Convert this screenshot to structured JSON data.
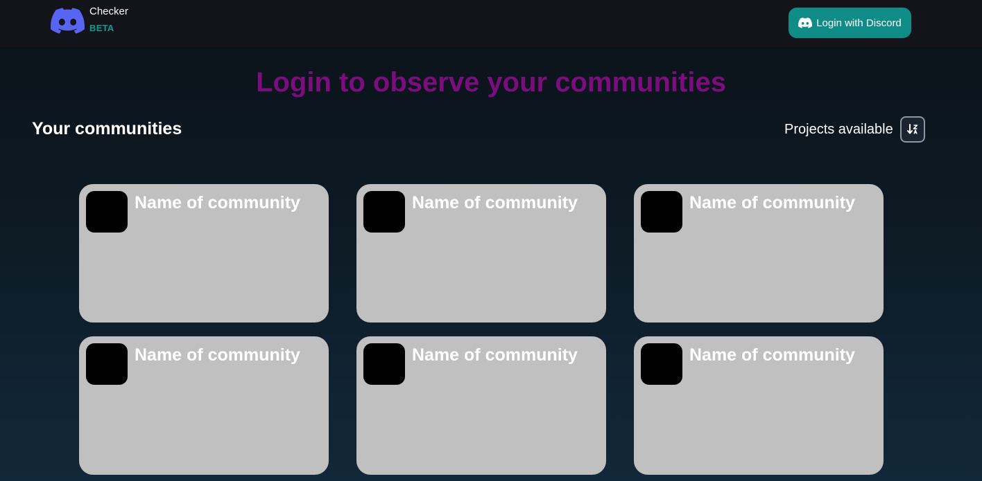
{
  "header": {
    "brand_name": "Checker",
    "brand_badge": "BETA",
    "logo_icon": "discord-logo-icon",
    "login_button_label": "Login with Discord",
    "login_button_icon": "discord-icon"
  },
  "hero": {
    "title": "Login to observe your communities"
  },
  "communities_section": {
    "title": "Your communities",
    "sort_label": "Projects available",
    "sort_icon": "sort-descending-icon"
  },
  "communities": [
    {
      "name": "Name of community"
    },
    {
      "name": "Name of community"
    },
    {
      "name": "Name of community"
    },
    {
      "name": "Name of community"
    },
    {
      "name": "Name of community"
    },
    {
      "name": "Name of community"
    }
  ],
  "colors": {
    "accent": "#0f8c88",
    "brand_badge": "#0f9b95",
    "hero_title": "#7b0d7e",
    "discord_blurple": "#5865f2",
    "card_background": "#c0c0c0",
    "avatar_placeholder": "#000000"
  }
}
